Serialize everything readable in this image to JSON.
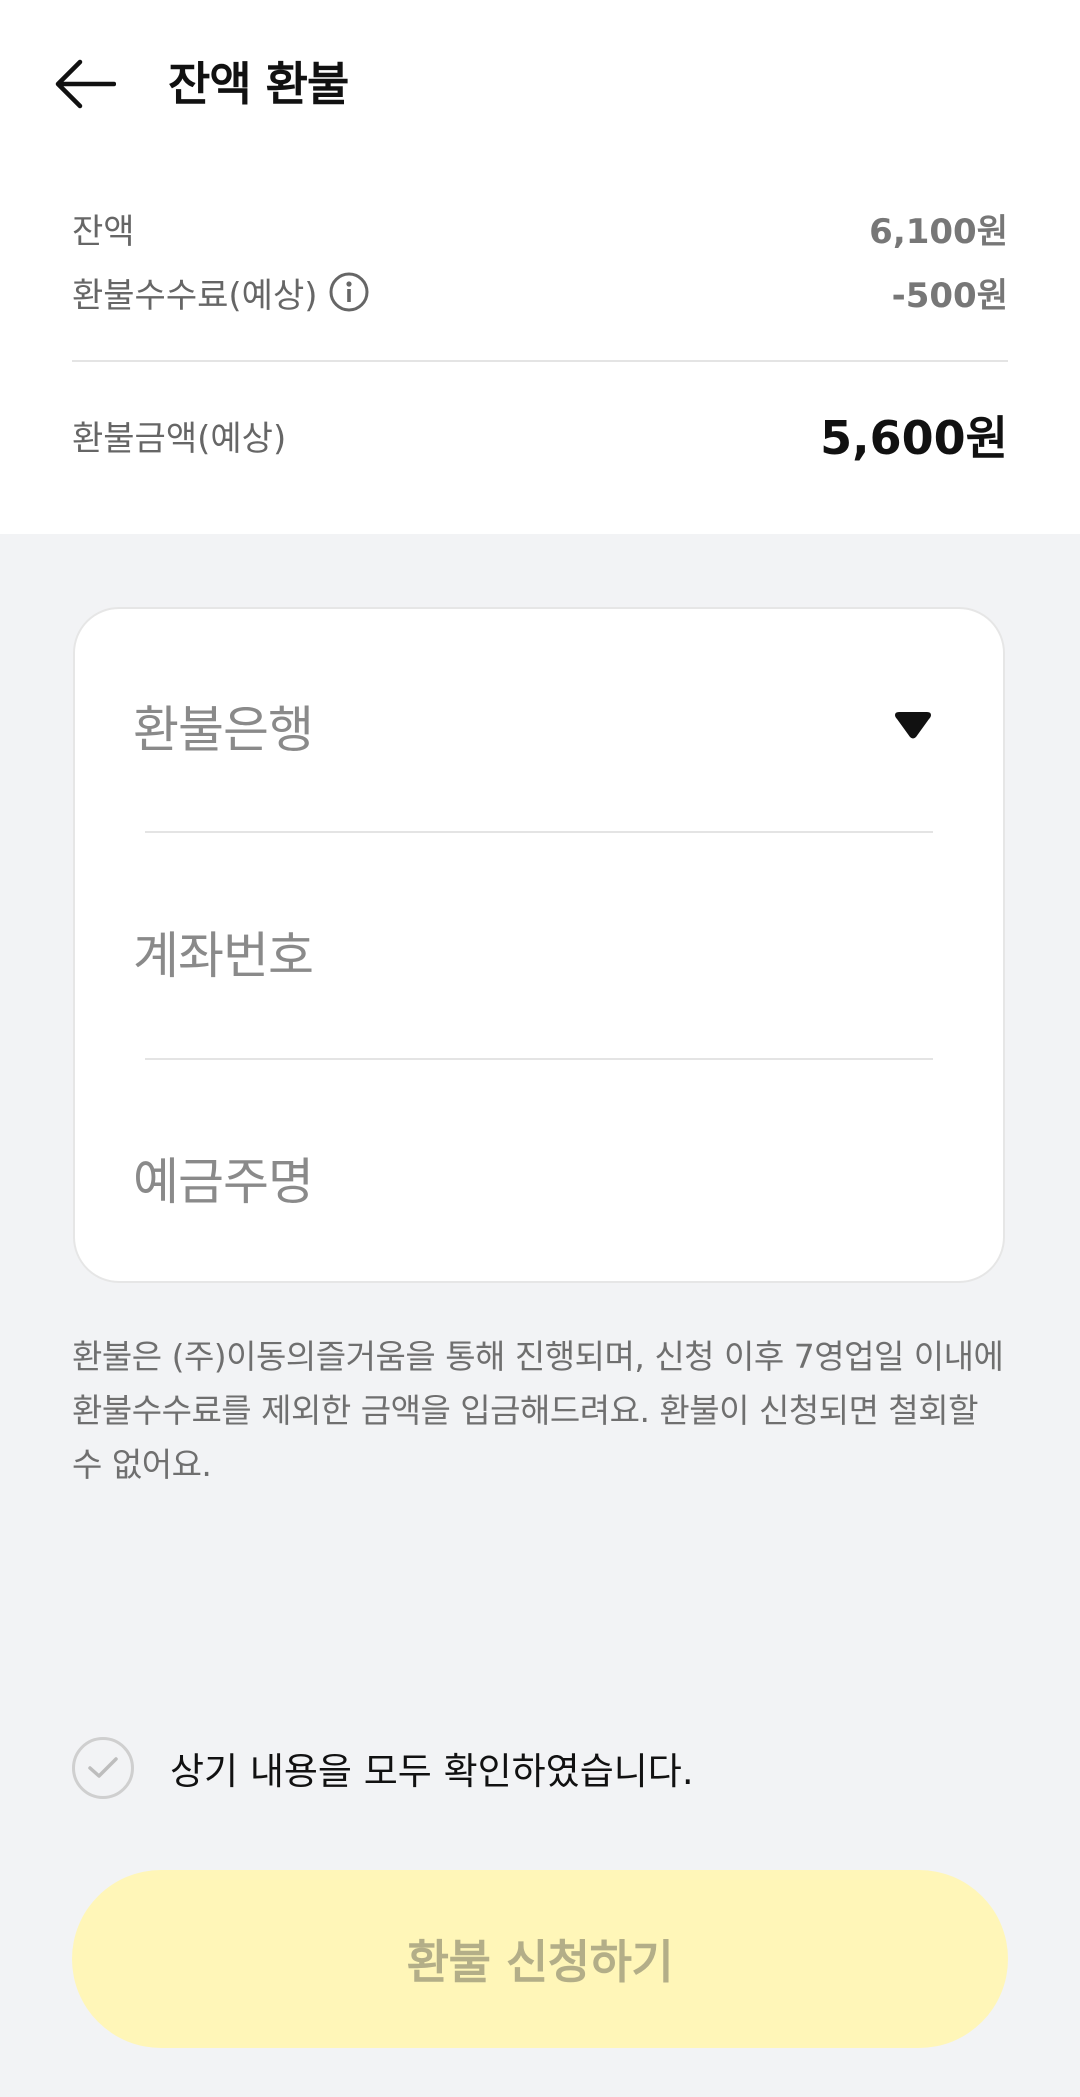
{
  "header": {
    "title": "잔액 환불",
    "back_icon": "arrow-left-icon"
  },
  "summary": {
    "balance_label": "잔액",
    "balance_value": "6,100원",
    "fee_label": "환불수수료(예상)",
    "fee_value": "-500원",
    "info_icon": "info-circle-icon",
    "refund_label": "환불금액(예상)",
    "refund_value": "5,600원"
  },
  "form": {
    "bank_placeholder": "환불은행",
    "account_placeholder": "계좌번호",
    "holder_placeholder": "예금주명",
    "dropdown_icon": "caret-down-icon"
  },
  "notice": "환불은 (주)이동의즐거움을 통해 진행되며, 신청 이후 7영업일 이내에 환불수수료를 제외한 금액을 입금해드려요. 환불이 신청되면 철회할 수 없어요.",
  "confirm": {
    "label": "상기 내용을 모두 확인하였습니다.",
    "checked": false
  },
  "submit_label": "환불 신청하기",
  "colors": {
    "background": "#f2f3f5",
    "button_disabled_bg": "#fff6b8",
    "button_disabled_text": "#b3ae88"
  }
}
